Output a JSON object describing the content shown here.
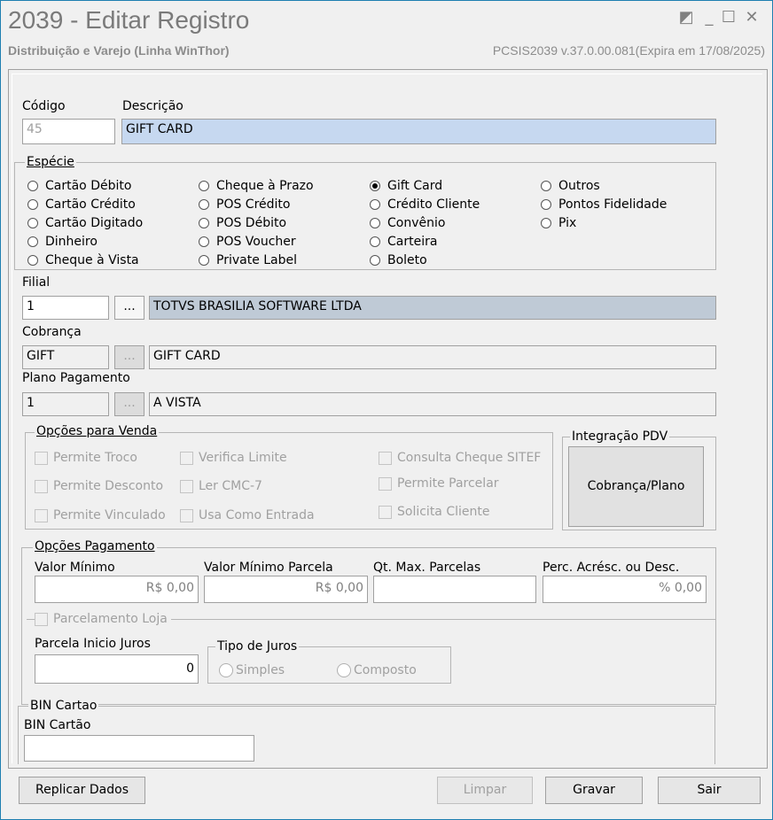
{
  "window": {
    "title": "2039 - Editar Registro",
    "subtitle": "Distribuição e Varejo (Linha WinThor)",
    "version": "PCSIS2039  v.37.0.00.081(Expira em 17/08/2025)",
    "controls": [
      "restore-icon",
      "minimize-icon",
      "maximize-icon",
      "close-icon"
    ],
    "controls_glyphs": [
      "◩",
      "_",
      "☐",
      "✕"
    ]
  },
  "header": {
    "codigo_label": "Código",
    "codigo_value": "45",
    "descricao_label": "Descrição",
    "descricao_value": "GIFT CARD"
  },
  "especie": {
    "title": "Espécie",
    "selected": "Gift Card",
    "col1": [
      "Cartão Débito",
      "Cartão Crédito",
      "Cartão Digitado",
      "Dinheiro",
      "Cheque à Vista"
    ],
    "col2": [
      "Cheque à Prazo",
      "POS Crédito",
      "POS Débito",
      "POS Voucher",
      "Private Label"
    ],
    "col3": [
      "Gift Card",
      "Crédito Cliente",
      "Convênio",
      "Carteira",
      "Boleto"
    ],
    "col4": [
      "Outros",
      "Pontos Fidelidade",
      "Pix"
    ]
  },
  "filial": {
    "label": "Filial",
    "code": "1",
    "lookup": "...",
    "name": "TOTVS BRASILIA SOFTWARE LTDA"
  },
  "cobranca": {
    "label": "Cobrança",
    "code": "GIFT",
    "lookup": "...",
    "name": "GIFT CARD"
  },
  "plano": {
    "label": "Plano Pagamento",
    "code": "1",
    "lookup": "...",
    "name": "A VISTA"
  },
  "opcoes_venda": {
    "title": "Opções para Venda",
    "col1": [
      "Permite Troco",
      "Permite Desconto",
      "Permite Vinculado"
    ],
    "col2": [
      "Verifica Limite",
      "Ler CMC-7",
      "Usa Como Entrada"
    ],
    "col3": [
      "Consulta Cheque SITEF",
      "Permite Parcelar",
      "Solicita Cliente"
    ]
  },
  "integracao": {
    "title": "Integração PDV",
    "button": "Cobrança/Plano"
  },
  "opcoes_pagamento": {
    "title": "Opções Pagamento",
    "valor_minimo_label": "Valor Mínimo",
    "valor_minimo": "R$ 0,00",
    "valor_minimo_parcela_label": "Valor Mínimo Parcela",
    "valor_minimo_parcela": "R$ 0,00",
    "qt_max_parcelas_label": "Qt. Max. Parcelas",
    "qt_max_parcelas": "",
    "perc_label": "Perc. Acrésc. ou Desc.",
    "perc": "% 0,00",
    "parcelamento_loja": "Parcelamento Loja",
    "parcela_inicio_label": "Parcela Inicio Juros",
    "parcela_inicio": "0",
    "tipo_juros_title": "Tipo de Juros",
    "tipo_juros_options": [
      "Simples",
      "Composto"
    ]
  },
  "bin": {
    "title": "BIN Cartao",
    "label": "BIN Cartão",
    "value": ""
  },
  "footer": {
    "replicar": "Replicar Dados",
    "limpar": "Limpar",
    "gravar": "Gravar",
    "sair": "Sair"
  }
}
